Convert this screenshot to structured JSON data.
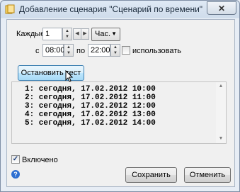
{
  "window": {
    "title": "Добавление сценария \"Сценарий по времени\"",
    "close_glyph": "✕"
  },
  "interval": {
    "label": "Каждые",
    "value": "1",
    "unit_selected": "Час."
  },
  "time_range": {
    "from_label": "с",
    "from_value": "08:00",
    "to_label": "по",
    "to_value": "22:00",
    "use_label": "использовать",
    "use_checked": false
  },
  "test_button_label": "Остановить тест",
  "log_lines": [
    "1: сегодня, 17.02.2012 10:00",
    "2: сегодня, 17.02.2012 11:00",
    "3: сегодня, 17.02.2012 12:00",
    "4: сегодня, 17.02.2012 13:00",
    "5: сегодня, 17.02.2012 14:00"
  ],
  "enabled": {
    "label": "Включено",
    "checked": true,
    "check_glyph": "✓"
  },
  "help_glyph": "?",
  "save_label": "Сохранить",
  "cancel_label": "Отменить",
  "icons": {
    "app": "scenario-app-icon",
    "help": "help-icon",
    "close": "close-icon"
  }
}
